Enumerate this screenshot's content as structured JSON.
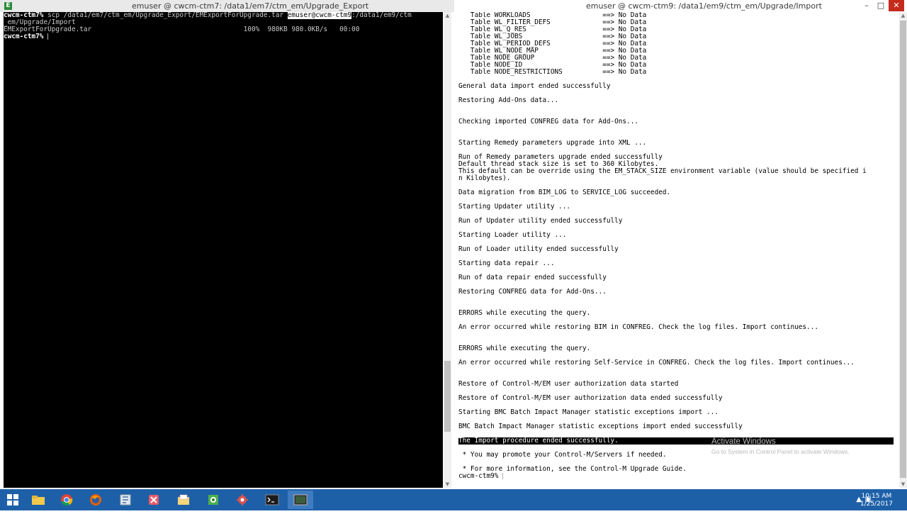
{
  "left_window": {
    "title": "emuser @ cwcm-ctm7: /data1/em7/ctm_em/Upgrade_Export",
    "icon_label": "E",
    "lines": [
      {
        "segments": [
          {
            "text": "cwcm-ctm7% ",
            "style": "prompt"
          },
          {
            "text": "scp /data1/em7/ctm_em/Upgrade_Export/EMExportForUpgrade.tar ",
            "style": "normal"
          },
          {
            "text": "emuser@cwcm-ctm9",
            "style": "hl"
          },
          {
            "text": ":/data1/em9/ctm",
            "style": "normal"
          }
        ]
      },
      {
        "segments": [
          {
            "text": "_em/Upgrade/Import",
            "style": "normal"
          }
        ]
      },
      {
        "segments": [
          {
            "text": "EMExportForUpgrade.tar                                      100%  980KB 980.0KB/s   00:00",
            "style": "normal"
          }
        ]
      },
      {
        "segments": [
          {
            "text": "cwcm-ctm7% ",
            "style": "prompt"
          }
        ],
        "cursor": true
      }
    ]
  },
  "right_window": {
    "title": "emuser @ cwcm-ctm9: /data1/em9/ctm_em/Upgrade/Import",
    "lines": [
      {
        "text": "   Table WORKLOADS                  ==> No Data"
      },
      {
        "text": "   Table WL_FILTER_DEFS             ==> No Data"
      },
      {
        "text": "   Table WL_Q_RES                   ==> No Data"
      },
      {
        "text": "   Table WL_JOBS                    ==> No Data"
      },
      {
        "text": "   Table WL_PERIOD_DEFS             ==> No Data"
      },
      {
        "text": "   Table WL_NODE_MAP                ==> No Data"
      },
      {
        "text": "   Table NODE_GROUP                 ==> No Data"
      },
      {
        "text": "   Table NODE_ID                    ==> No Data"
      },
      {
        "text": "   Table NODE_RESTRICTIONS          ==> No Data"
      },
      {
        "text": ""
      },
      {
        "text": "General data import ended successfully"
      },
      {
        "text": ""
      },
      {
        "text": "Restoring Add-Ons data..."
      },
      {
        "text": ""
      },
      {
        "text": ""
      },
      {
        "text": "Checking imported CONFREG data for Add-Ons..."
      },
      {
        "text": ""
      },
      {
        "text": ""
      },
      {
        "text": "Starting Remedy parameters upgrade into XML ..."
      },
      {
        "text": ""
      },
      {
        "text": "Run of Remedy parameters upgrade ended successfully"
      },
      {
        "text": "Default thread stack size is set to 360 Kilobytes."
      },
      {
        "text": "This default can be override using the EM_STACK_SIZE environment variable (value should be specified i"
      },
      {
        "text": "n Kilobytes)."
      },
      {
        "text": ""
      },
      {
        "text": "Data migration from BIM_LOG to SERVICE_LOG succeeded."
      },
      {
        "text": ""
      },
      {
        "text": "Starting Updater utility ..."
      },
      {
        "text": ""
      },
      {
        "text": "Run of Updater utility ended successfully"
      },
      {
        "text": ""
      },
      {
        "text": "Starting Loader utility ..."
      },
      {
        "text": ""
      },
      {
        "text": "Run of Loader utility ended successfully"
      },
      {
        "text": ""
      },
      {
        "text": "Starting data repair ..."
      },
      {
        "text": ""
      },
      {
        "text": "Run of data repair ended successfully"
      },
      {
        "text": ""
      },
      {
        "text": "Restoring CONFREG data for Add-Ons..."
      },
      {
        "text": ""
      },
      {
        "text": ""
      },
      {
        "text": "ERRORS while executing the query."
      },
      {
        "text": ""
      },
      {
        "text": "An error occurred while restoring BIM in CONFREG. Check the log files. Import continues..."
      },
      {
        "text": ""
      },
      {
        "text": ""
      },
      {
        "text": "ERRORS while executing the query."
      },
      {
        "text": ""
      },
      {
        "text": "An error occurred while restoring Self-Service in CONFREG. Check the log files. Import continues..."
      },
      {
        "text": ""
      },
      {
        "text": ""
      },
      {
        "text": "Restore of Control-M/EM user authorization data started"
      },
      {
        "text": ""
      },
      {
        "text": "Restore of Control-M/EM user authorization data ended successfully"
      },
      {
        "text": ""
      },
      {
        "text": "Starting BMC Batch Impact Manager statistic exceptions import ..."
      },
      {
        "text": ""
      },
      {
        "text": "BMC Batch Impact Manager statistic exceptions import ended successfully"
      },
      {
        "text": ""
      },
      {
        "text": "The Import procedure ended successfully.",
        "highlight": true
      },
      {
        "text": ""
      },
      {
        "text": " * You may promote your Control-M/Servers if needed."
      },
      {
        "text": ""
      },
      {
        "text": " * For more information, see the Control-M Upgrade Guide."
      },
      {
        "text": "cwcm-ctm9% ",
        "cursor": true
      }
    ]
  },
  "watermark": {
    "title": "Activate Windows",
    "subtitle": "Go to System in Control Panel to activate Windows."
  },
  "taskbar": {
    "apps": [
      {
        "name": "start-button",
        "icon": "windows-logo"
      },
      {
        "name": "file-explorer",
        "icon": "folder-icon"
      },
      {
        "name": "chrome",
        "icon": "chrome-icon"
      },
      {
        "name": "firefox",
        "icon": "firefox-icon"
      },
      {
        "name": "app-blueprint",
        "icon": "blueprint-icon"
      },
      {
        "name": "app-tools",
        "icon": "tools-icon"
      },
      {
        "name": "app-explorer",
        "icon": "folder-shell-icon"
      },
      {
        "name": "app-network",
        "icon": "network-icon"
      },
      {
        "name": "app-gear",
        "icon": "gear-icon"
      },
      {
        "name": "powershell",
        "icon": "terminal-icon"
      },
      {
        "name": "terminal-emulator",
        "icon": "terminal-emulator-icon",
        "active": true
      }
    ],
    "time": "10:15 AM",
    "date": "1/25/2017"
  },
  "colors": {
    "terminal_bg_left": "#000000",
    "terminal_fg_left": "#c8c8c8",
    "terminal_bg_right": "#ffffff",
    "highlight_bg": "#000000",
    "taskbar": "#1e60a8",
    "close_button": "#c42b1c"
  }
}
